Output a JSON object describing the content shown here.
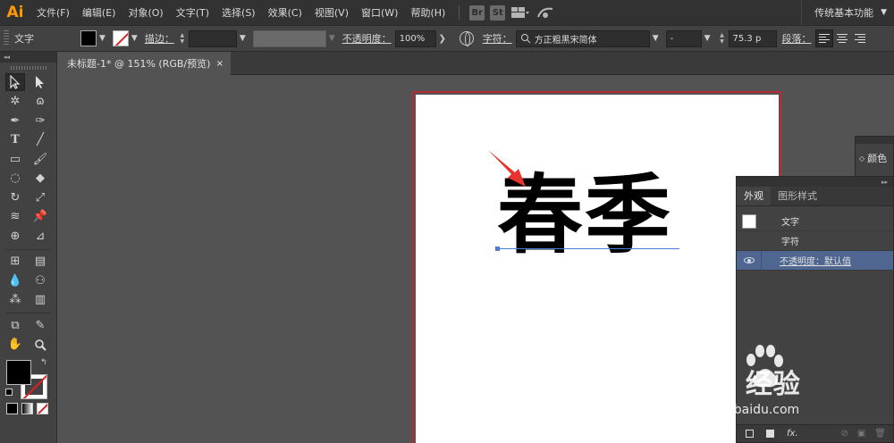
{
  "app": {
    "logo": "Ai"
  },
  "menu": [
    "文件(F)",
    "编辑(E)",
    "对象(O)",
    "文字(T)",
    "选择(S)",
    "效果(C)",
    "视图(V)",
    "窗口(W)",
    "帮助(H)"
  ],
  "menubar_icons": {
    "bridge": "Br",
    "stock": "St"
  },
  "workspace": "传统基本功能",
  "control": {
    "tool_name": "文字",
    "stroke_label": "描边：",
    "opacity_label": "不透明度：",
    "opacity_value": "100%",
    "char_label": "字符：",
    "font_name": "方正粗黑宋简体",
    "font_style": "-",
    "font_size": "75.3 p",
    "para_label": "段落："
  },
  "document": {
    "tab_title": "未标题-1* @ 151% (RGB/预览)",
    "close": "×"
  },
  "artboard": {
    "text": "春季"
  },
  "panels": {
    "color": {
      "label": "颜色"
    },
    "appearance": {
      "tabs": [
        "外观",
        "图形样式"
      ],
      "rows": [
        "文字",
        "字符",
        "不透明度：默认值"
      ],
      "bottom_fx": "fx."
    }
  },
  "watermark": {
    "brand": "Bai  经验",
    "url": "jingyan.baidu.com"
  },
  "colors": {
    "accent": "#ff9a00",
    "selection": "#4f6690",
    "artboard_border": "#b52b3a",
    "arrow": "#e8332f",
    "baseline": "#4a7fd4"
  }
}
